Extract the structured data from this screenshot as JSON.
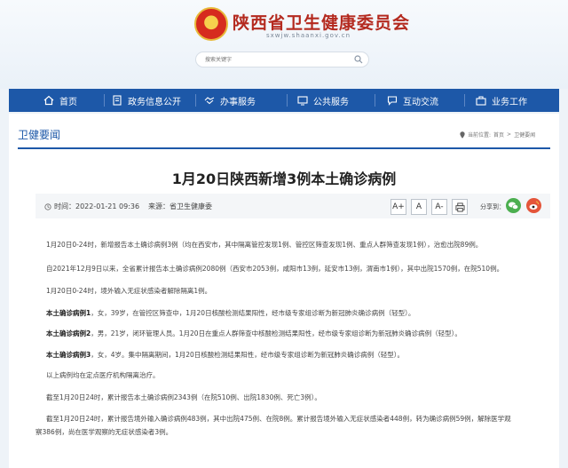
{
  "site": {
    "title": "陕西省卫生健康委员会",
    "url": "sxwjw.shaanxi.gov.cn",
    "search_placeholder": "搜索关键字"
  },
  "nav": [
    {
      "label": "首页",
      "icon": "home-icon"
    },
    {
      "label": "政务信息公开",
      "icon": "document-icon"
    },
    {
      "label": "办事服务",
      "icon": "handshake-icon"
    },
    {
      "label": "公共服务",
      "icon": "monitor-icon"
    },
    {
      "label": "互动交流",
      "icon": "chat-icon"
    },
    {
      "label": "业务工作",
      "icon": "briefcase-icon"
    }
  ],
  "section": {
    "title": "卫健要闻",
    "breadcrumb": [
      "当前位置:",
      "首页",
      ">",
      "卫健要闻"
    ]
  },
  "article": {
    "title": "1月20日陕西新增3例本土确诊病例",
    "time_label": "时间：2022-01-21 09:36",
    "source_label": "来源：省卫生健康委",
    "font_buttons": [
      "A+",
      "A",
      "A-"
    ],
    "share_label": "分享到：",
    "paragraphs": [
      {
        "bold": "",
        "text": "1月20日0-24时，新增报告本土确诊病例3例（均在西安市，其中隔离管控发现1例、管控区筛查发现1例、重点人群筛查发现1例），治愈出院89例。"
      },
      {
        "bold": "",
        "text": "自2021年12月9日以来，全省累计报告本土确诊病例2080例（西安市2053例，咸阳市13例，延安市13例，渭南市1例），其中出院1570例，在院510例。"
      },
      {
        "bold": "",
        "text": "1月20日0-24时，境外输入无症状感染者解除隔离1例。"
      },
      {
        "bold": "本土确诊病例1",
        "text": "，女，39岁，在管控区筛查中，1月20日核酸检测结果阳性，经市级专家组诊断为新冠肺炎确诊病例（轻型）。"
      },
      {
        "bold": "本土确诊病例2",
        "text": "，男，21岁，闭环管理人员。1月20日在重点人群筛查中核酸检测结果阳性，经市级专家组诊断为新冠肺炎确诊病例（轻型）。"
      },
      {
        "bold": "本土确诊病例3",
        "text": "，女，4岁。集中隔离期间，1月20日核酸检测结果阳性，经市级专家组诊断为新冠肺炎确诊病例（轻型）。"
      },
      {
        "bold": "",
        "text": "以上病例均在定点医疗机构隔离治疗。"
      },
      {
        "bold": "",
        "text": "截至1月20日24时，累计报告本土确诊病例2343例（在院510例、出院1830例、死亡3例）。"
      },
      {
        "bold": "",
        "text": "截至1月20日24时，累计报告境外输入确诊病例483例，其中出院475例、在院8例。累计报告境外输入无症状感染者448例，转为确诊病例59例，解除医学观"
      },
      {
        "bold": "",
        "text": "察386例，尚在医学观察的无症状感染者3例。"
      }
    ]
  },
  "colors": {
    "brand_blue": "#1d58a8",
    "title_red": "#b42a1f",
    "wechat_green": "#4caf50",
    "weibo_red": "#e4553a"
  }
}
